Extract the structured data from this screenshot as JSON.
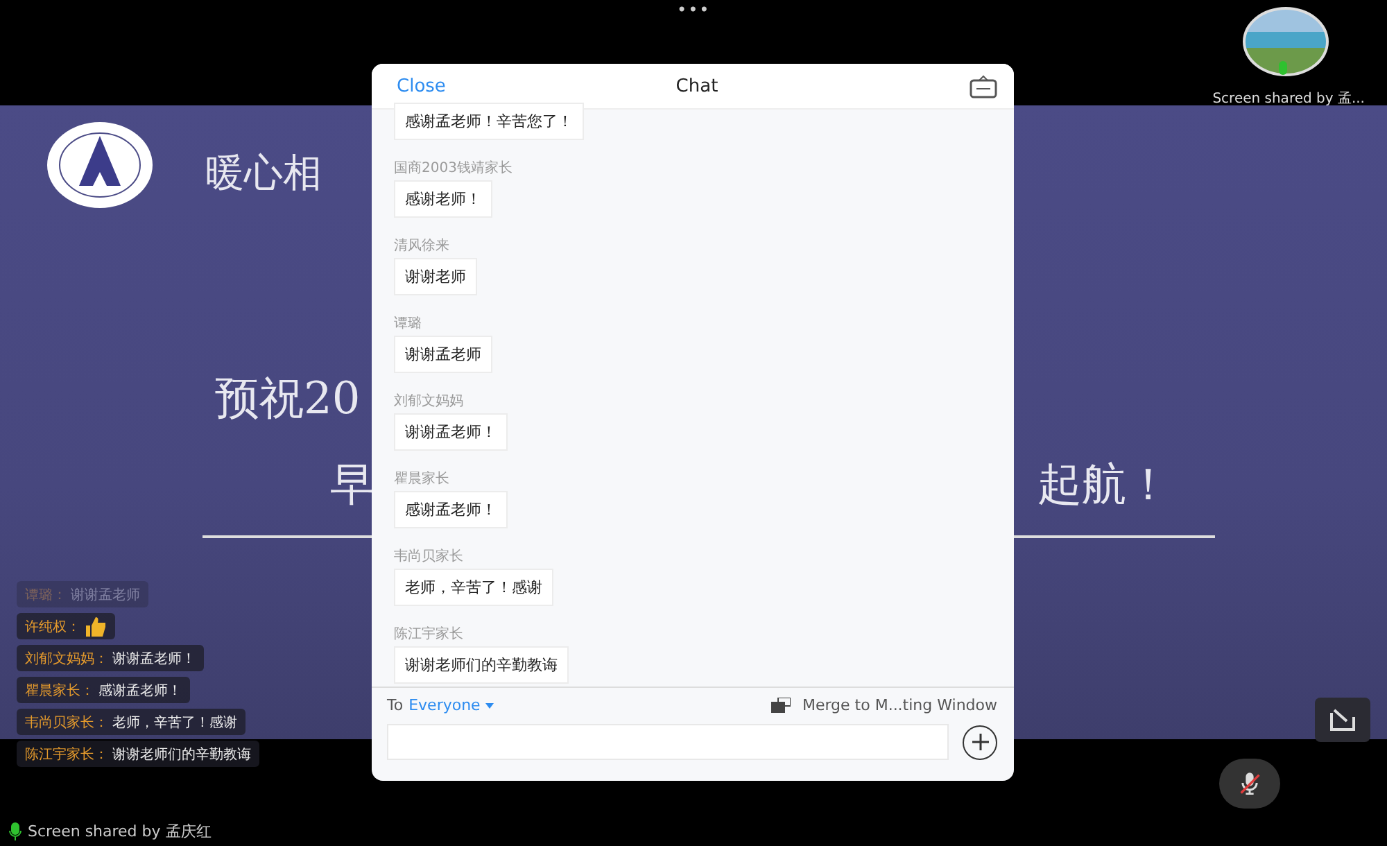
{
  "top_bar": {
    "more_icon": "•••",
    "presenter": {
      "label": "Screen shared by 孟..."
    }
  },
  "slide": {
    "title_fragment": "暖心相",
    "line_1_fragment": "预祝20",
    "line_2_left": "早",
    "line_2_right": "起航！"
  },
  "overlay_chat": [
    {
      "sender": "谭璐：",
      "text": "谢谢孟老师",
      "faded": true,
      "kind": "text"
    },
    {
      "sender": "许纯权：",
      "faded": false,
      "kind": "thumbs"
    },
    {
      "sender": "刘郁文妈妈：",
      "text": "谢谢孟老师！",
      "faded": false,
      "kind": "text"
    },
    {
      "sender": "瞿晨家长：",
      "text": "感谢孟老师！",
      "faded": false,
      "kind": "text"
    },
    {
      "sender": "韦尚贝家长：",
      "text": "老师，辛苦了！感谢",
      "faded": false,
      "kind": "text"
    },
    {
      "sender": "陈江宇家长：",
      "text": "谢谢老师们的辛勤教诲",
      "faded": false,
      "kind": "text"
    }
  ],
  "chat": {
    "close": "Close",
    "title": "Chat",
    "messages": [
      {
        "text": "感谢孟老师！辛苦您了！"
      },
      {
        "sender": "国商2003钱靖家长",
        "text": "感谢老师！"
      },
      {
        "sender": "清风徐来",
        "text": "谢谢老师"
      },
      {
        "sender": "谭璐",
        "text": "谢谢孟老师"
      },
      {
        "sender": "刘郁文妈妈",
        "text": "谢谢孟老师！"
      },
      {
        "sender": "瞿晨家长",
        "text": "感谢孟老师！"
      },
      {
        "sender": "韦尚贝家长",
        "text": "老师，辛苦了！感谢"
      },
      {
        "sender": "陈江宇家长",
        "text": "谢谢老师们的辛勤教诲"
      }
    ],
    "to_label": "To",
    "recipient": "Everyone",
    "merge": "Merge to M...ting Window"
  },
  "status": {
    "shared_by": "Screen shared by 孟庆红",
    "muted": true
  }
}
